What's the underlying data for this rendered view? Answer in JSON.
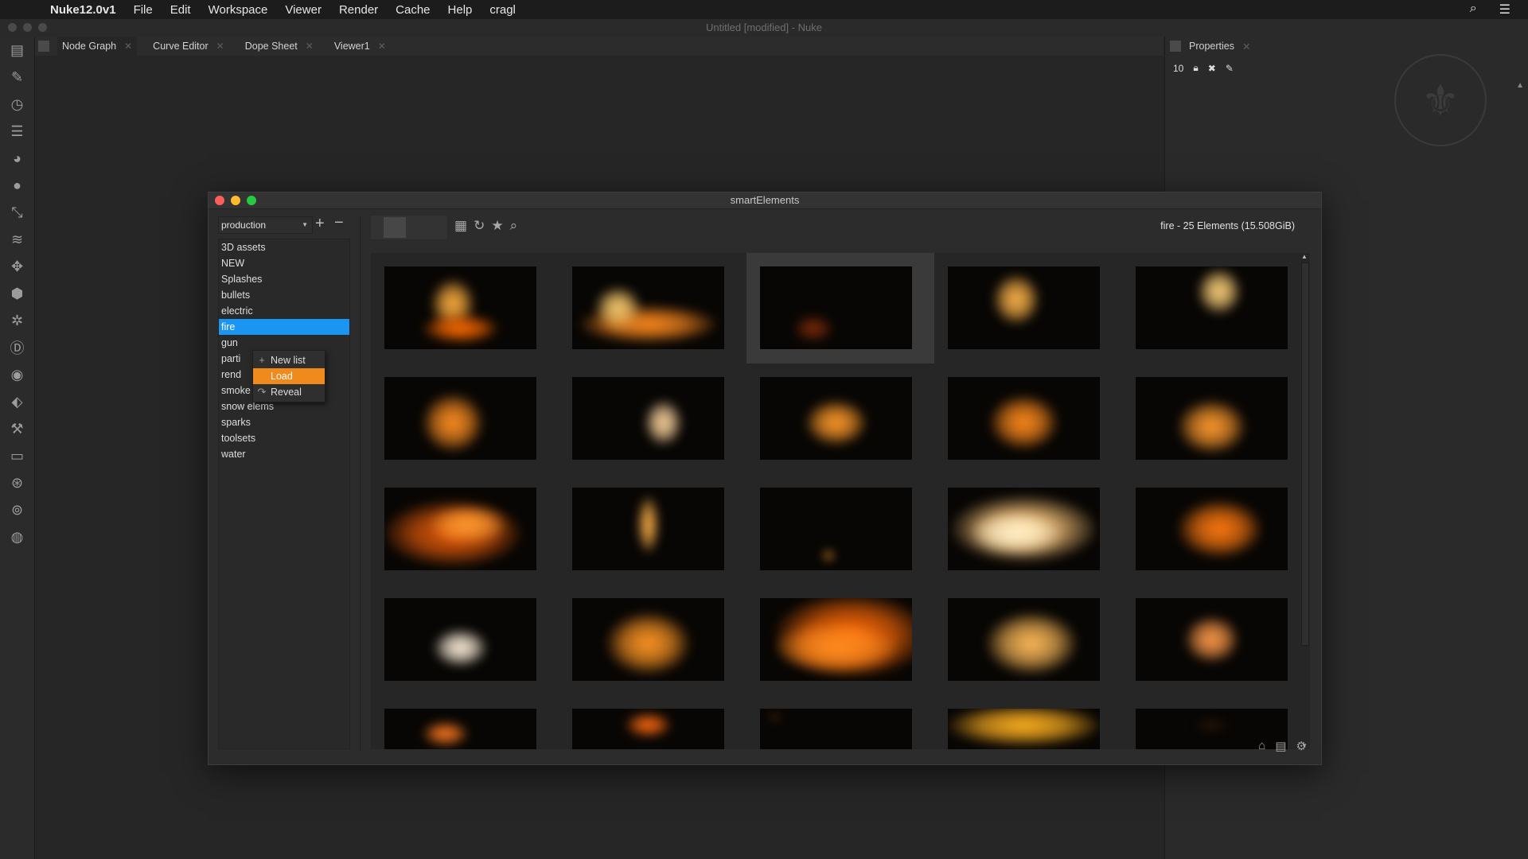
{
  "menubar": {
    "app": "Nuke12.0v1",
    "items": [
      "File",
      "Edit",
      "Workspace",
      "Viewer",
      "Render",
      "Cache",
      "Help",
      "cragl"
    ]
  },
  "window_title": "Untitled [modified] - Nuke",
  "tabs": [
    {
      "label": "Node Graph"
    },
    {
      "label": "Curve Editor"
    },
    {
      "label": "Dope Sheet"
    },
    {
      "label": "Viewer1"
    }
  ],
  "properties": {
    "title": "Properties",
    "max_panels": "10"
  },
  "toolbar_icons": [
    "toolsets-icon",
    "draw-icon",
    "time-icon",
    "channel-icon",
    "color-icon",
    "filter-icon",
    "keyer-icon",
    "merge-icon",
    "transform-icon",
    "3d-icon",
    "particles-icon",
    "deep-icon",
    "views-icon",
    "metadata-icon",
    "other-icon",
    "furnace-icon",
    "ocula-icon",
    "cara-vr-icon",
    "nuke-logo-icon"
  ],
  "se": {
    "title": "smartElements",
    "project": "production",
    "categories": [
      "3D assets",
      "NEW",
      "Splashes",
      "bullets",
      "electric",
      "fire",
      "gun",
      "parti",
      "rend",
      "smoke",
      "snow elems",
      "sparks",
      "toolsets",
      "water"
    ],
    "selected_index": 5,
    "context_menu": [
      {
        "label": "New list",
        "icon": "plus-icon"
      },
      {
        "label": "Load",
        "icon": "load-icon"
      },
      {
        "label": "Reveal",
        "icon": "reveal-icon"
      }
    ],
    "info": "fire - 25 Elements (15.508GiB)",
    "accent": "#1a95f2",
    "highlight": "#f08a1c"
  }
}
